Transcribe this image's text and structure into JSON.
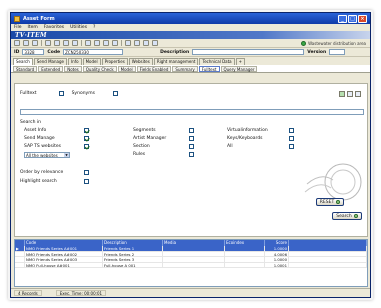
{
  "window": {
    "title": "Asset Form",
    "controls": [
      "_",
      "□",
      "×"
    ]
  },
  "menu": [
    "File",
    "Item",
    "Favorites",
    "Utilities",
    "?"
  ],
  "banner": "TV·ITEM",
  "toolbar": {
    "status_text": "Wastewater distribution area"
  },
  "idbar": {
    "id_label": "ID",
    "id_value": "3328",
    "code_label": "Code",
    "code_value": "ZCN250330",
    "description_label": "Description",
    "version_label": "Version"
  },
  "tabs": [
    "Search",
    "Send Manage",
    "Info",
    "Model",
    "Properties",
    "Websites",
    "Right management",
    "Technical Data",
    "+"
  ],
  "subtabs": [
    "Standard",
    "Extended",
    "Notes",
    "Quality Check",
    "Model",
    "Fields Enabled",
    "Summary",
    "Fulltext",
    "Query Manager"
  ],
  "search": {
    "fulltext_label": "Fulltext",
    "synonyms_label": "Synonyms",
    "search_in_label": "Search in",
    "options": [
      {
        "label": "Asset Info",
        "checked": true
      },
      {
        "label": "Send Manage",
        "checked": true
      },
      {
        "label": "SAP TS websites",
        "checked": true
      },
      {
        "label": "Segments",
        "checked": false
      },
      {
        "label": "Artist Manager",
        "checked": false
      },
      {
        "label": "Section",
        "checked": false
      },
      {
        "label": "Rules",
        "checked": false
      },
      {
        "label": "Virtualinformation",
        "checked": false
      },
      {
        "label": "Keys/Keyboards",
        "checked": false
      },
      {
        "label": "All",
        "checked": false
      }
    ],
    "select_value": "All the websites",
    "order_label": "Order by relevance",
    "highlight_label": "Highlight search"
  },
  "buttons": {
    "reset": "RESET",
    "search": "Search"
  },
  "grid": {
    "columns": [
      "",
      "Code",
      "Description",
      "Media",
      "Ecoindex",
      "Score"
    ],
    "rows": [
      {
        "code": "NMO Friends Series A#001",
        "description": "Friends Series 1",
        "media": "",
        "eco": "",
        "score": "1.0000",
        "selected": true
      },
      {
        "code": "NMO Friends Series A#002",
        "description": "Friends Series 2",
        "media": "",
        "eco": "",
        "score": "4.0006",
        "selected": false
      },
      {
        "code": "NMO Friends Series A#003",
        "description": "Friends Series 3",
        "media": "",
        "eco": "",
        "score": "1.0000",
        "selected": false
      },
      {
        "code": "NMO Full-house A#001",
        "description": "Full-house A 001",
        "media": "",
        "eco": "",
        "score": "1.0001",
        "selected": false
      }
    ]
  },
  "status": {
    "records": "4 Records",
    "time": "Exec. Time: 00:00:01"
  },
  "colors": {
    "title_bar": "#0e3aa8",
    "grid_header": "#3a64c8",
    "window_bg": "#ece9d8"
  }
}
